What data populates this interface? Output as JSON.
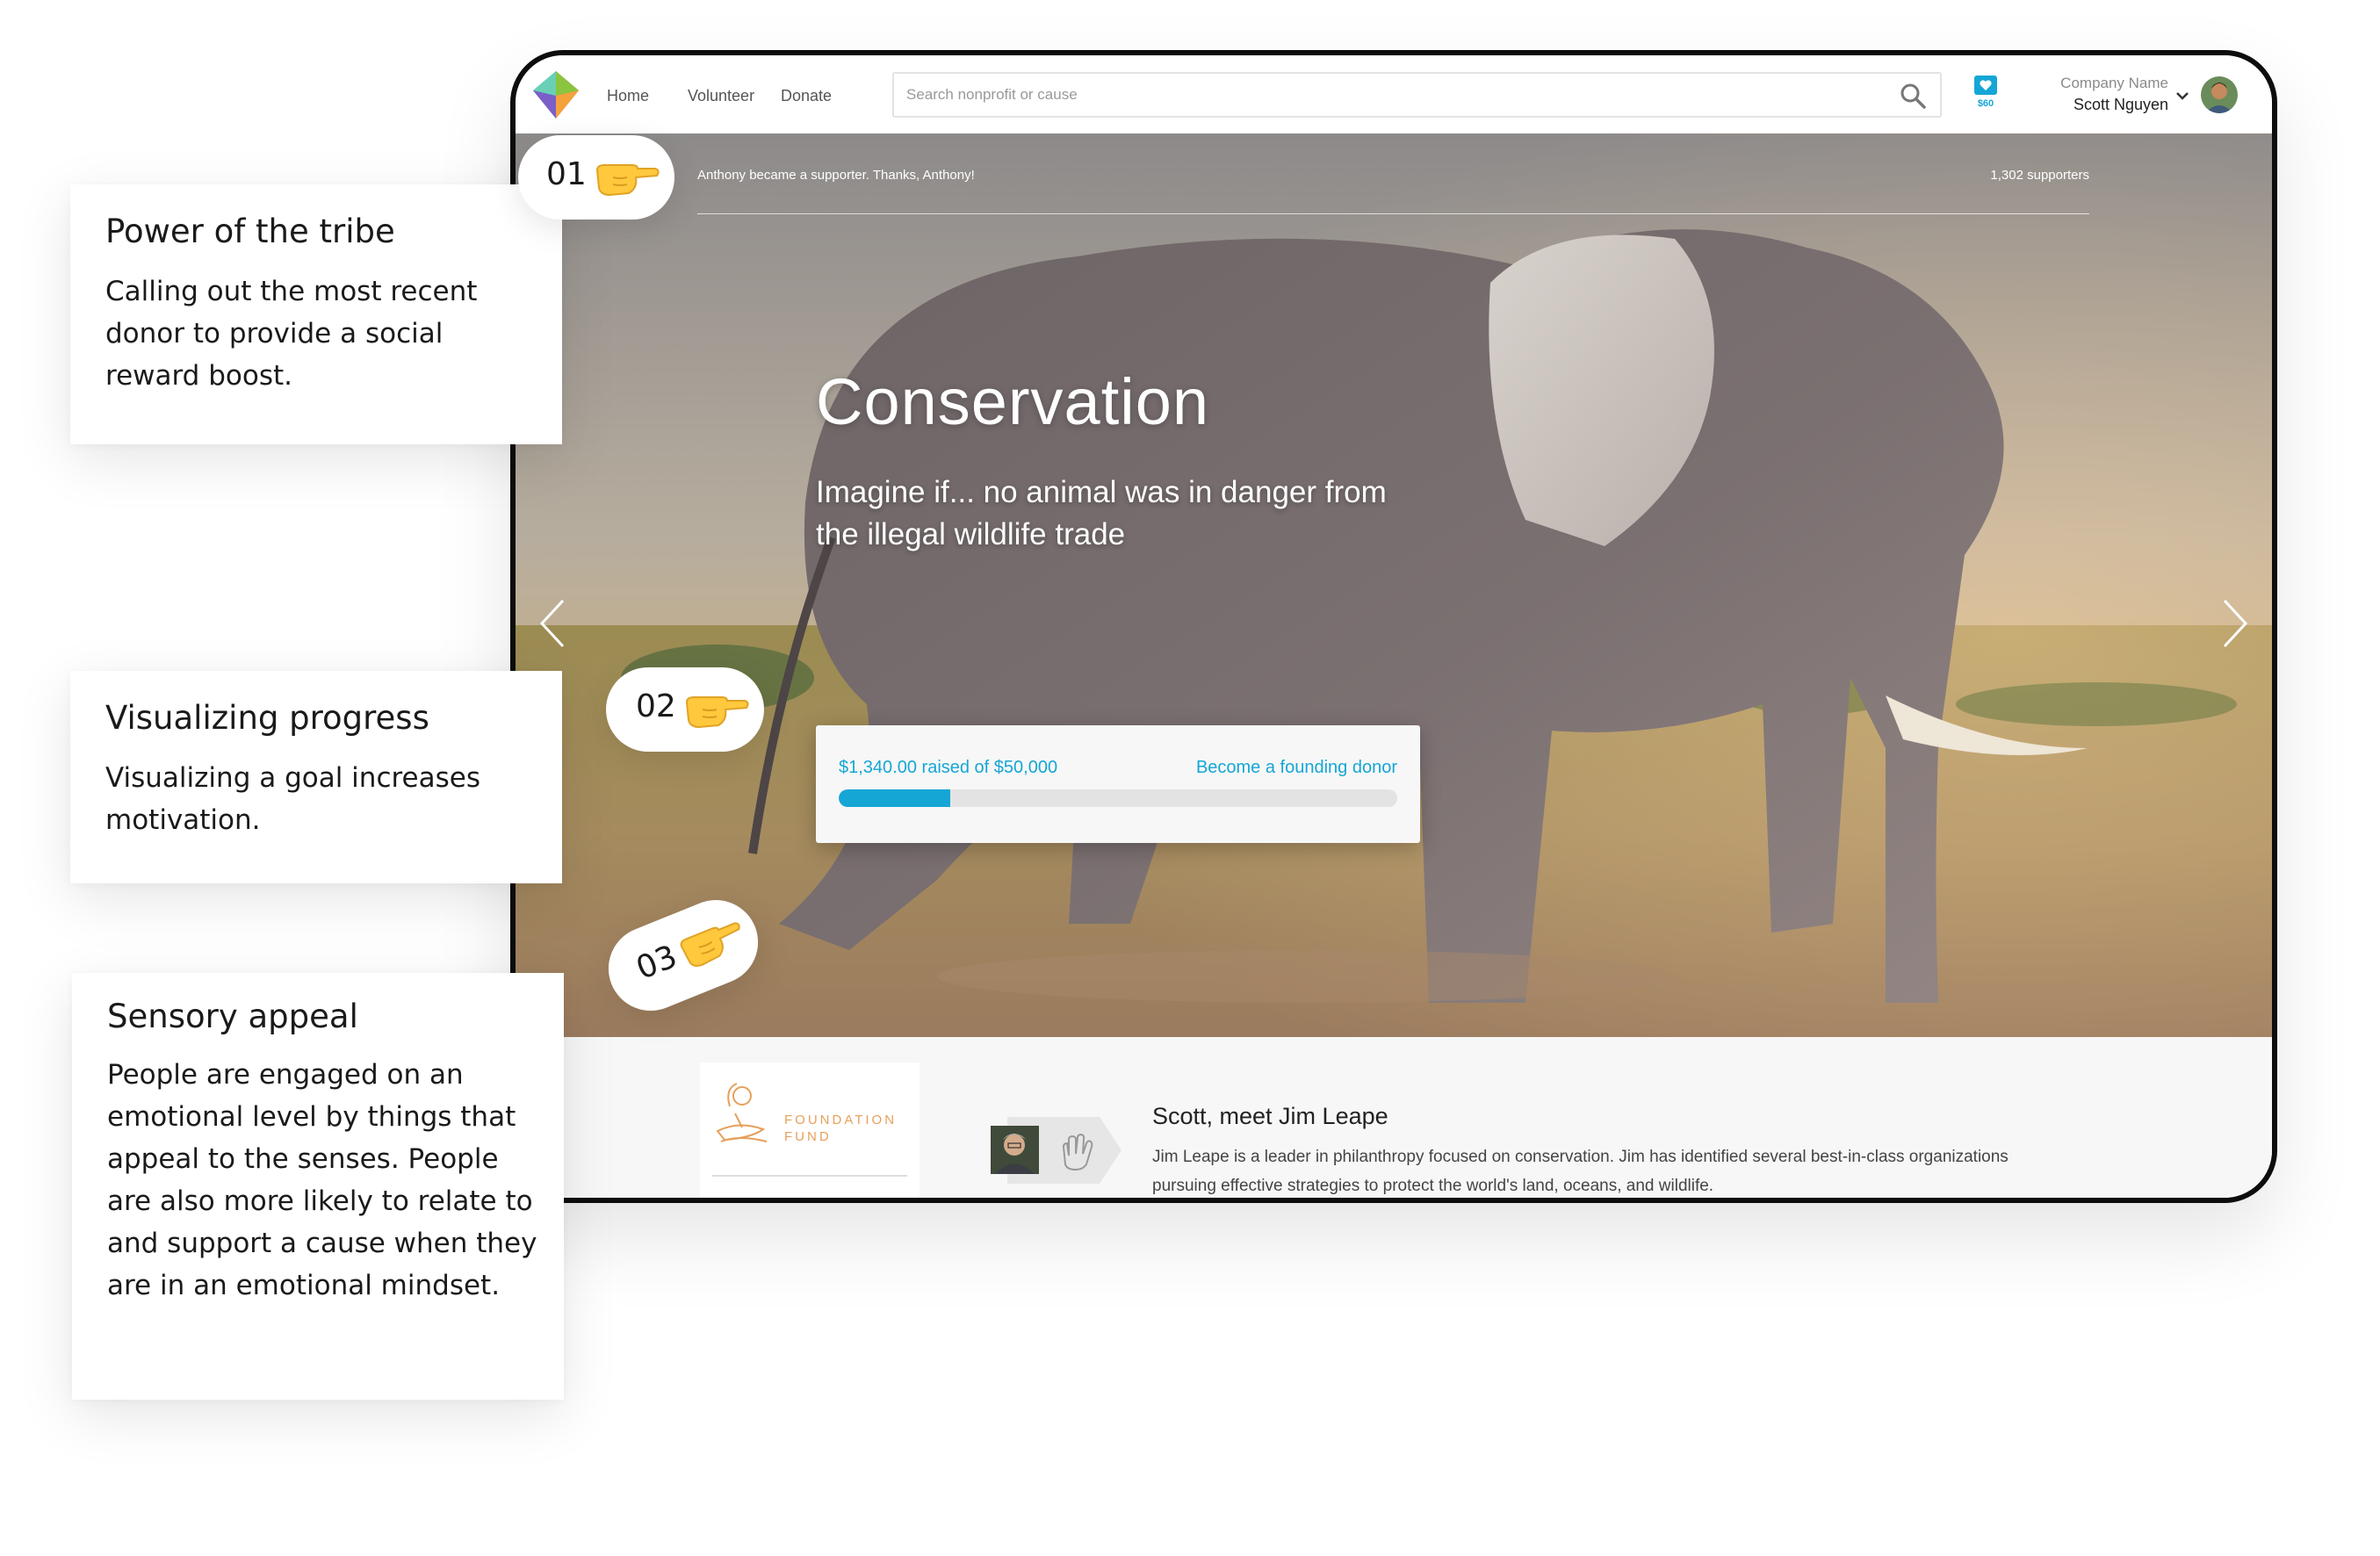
{
  "nav": {
    "links": [
      "Home",
      "Volunteer",
      "Donate"
    ],
    "search_placeholder": "Search nonprofit or cause",
    "wallet_amount": "$60",
    "company": "Company Name",
    "user": "Scott Nguyen"
  },
  "hero": {
    "ticker": "Anthony became a supporter. Thanks, Anthony!",
    "supporters": "1,302 supporters",
    "title": "Conservation",
    "subtitle": "Imagine if... no animal was in danger from the illegal wildlife trade",
    "raised": "$1,340.00 raised of $50,000",
    "cta": "Become a founding donor",
    "progress_fraction": 0.2
  },
  "bottom": {
    "fund_name": "FOUNDATION FUND",
    "meet_title": "Scott, meet Jim Leape",
    "meet_desc": "Jim Leape is a leader in philanthropy focused on conservation. Jim has identified several best-in-class organizations pursuing effective strategies to protect the world's land, oceans, and wildlife."
  },
  "callouts": [
    {
      "num": "01",
      "title": "Power of the tribe",
      "body": "Calling out the most recent donor to provide a social reward boost."
    },
    {
      "num": "02",
      "title": "Visualizing progress",
      "body": "Visualizing a goal increases motivation."
    },
    {
      "num": "03",
      "title": "Sensory appeal",
      "body": "People are engaged on an emotional level by things that appeal to the senses. People are also more likely to relate to and support a cause when they are in an emotional mindset."
    }
  ],
  "colors": {
    "accent": "#15a6d6",
    "fund": "#e6a05a",
    "frame": "#0d0d0d"
  },
  "icons": [
    "logo-icon",
    "search-icon",
    "heart-wallet-icon",
    "chevron-down-icon",
    "arrow-left-icon",
    "arrow-right-icon",
    "pointing-hand-icon",
    "high-five-icon"
  ]
}
